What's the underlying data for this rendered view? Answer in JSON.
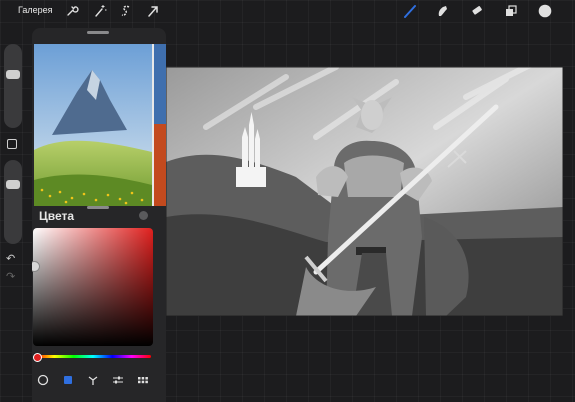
{
  "topbar": {
    "gallery_label": "Галерея",
    "left_tools": [
      "wrench-icon",
      "magic-wand-icon",
      "selection-icon",
      "transform-arrow-icon"
    ],
    "right_tools": [
      "brush-icon",
      "smudge-icon",
      "eraser-icon",
      "layers-icon",
      "color-swatch-icon"
    ]
  },
  "colors_panel": {
    "title": "Цвета",
    "selected_color": "#e0201e",
    "modes": [
      "disc-icon",
      "classic-icon",
      "harmony-icon",
      "value-icon",
      "palettes-icon"
    ]
  },
  "theme": {
    "accent": "#2f6fe0",
    "panel_bg": "#262628"
  }
}
